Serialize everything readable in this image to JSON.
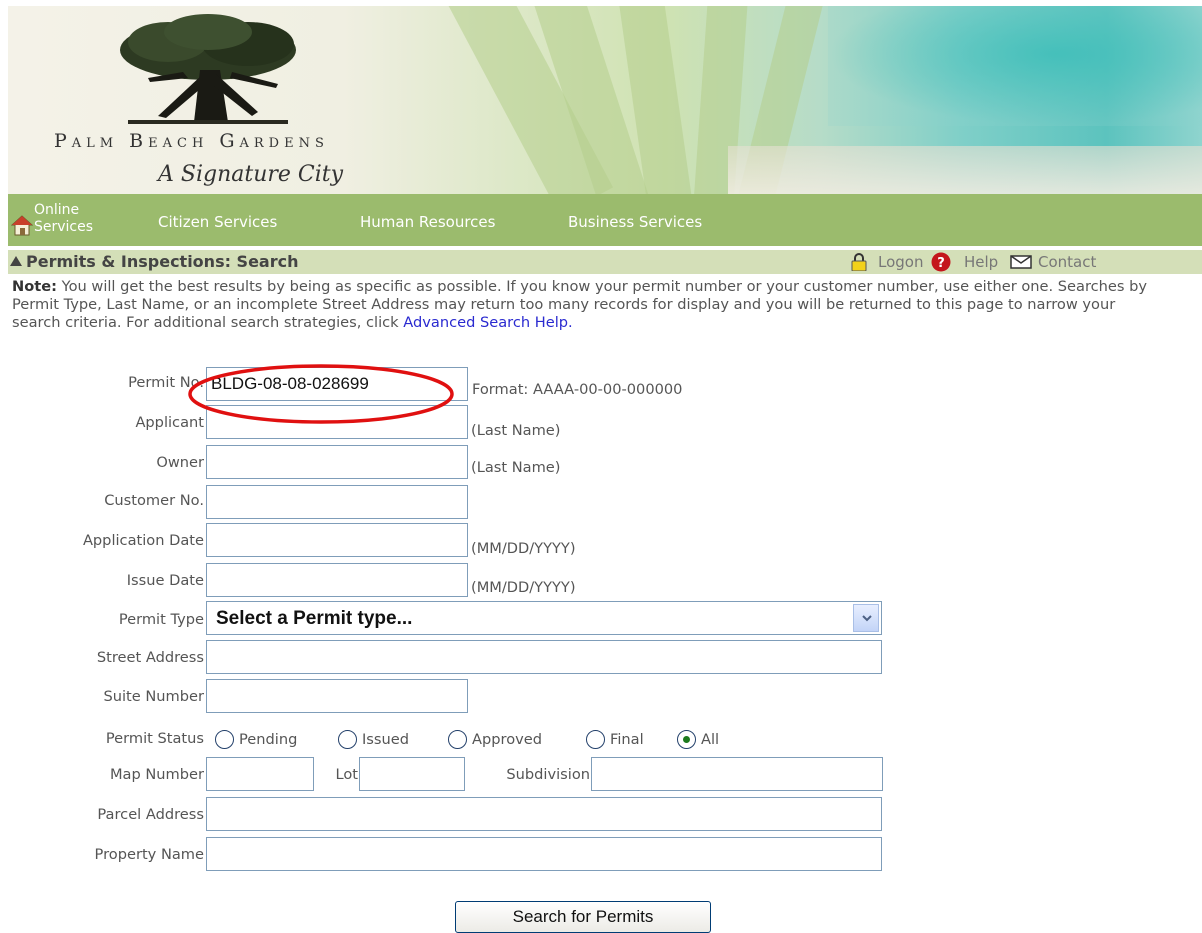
{
  "banner": {
    "brand_name": "Palm Beach Gardens",
    "tagline": "A Signature City"
  },
  "nav": {
    "online_services": [
      "Online",
      "Services"
    ],
    "items": [
      "Citizen Services",
      "Human Resources",
      "Business Services"
    ]
  },
  "titlebar": {
    "title": "Permits & Inspections: Search",
    "logon": "Logon",
    "help": "Help",
    "contact": "Contact"
  },
  "note": {
    "label": "Note:",
    "text": " You will get the best results by being as specific as possible. If you know your permit number or your customer number, use either one. Searches by Permit Type, Last Name, or an incomplete Street Address may return too many records for display and you will be returned to this page to narrow your search criteria. For additional search strategies, click ",
    "link": "Advanced Search Help."
  },
  "form": {
    "permit_no": {
      "label": "Permit No.",
      "value": "BLDG-08-08-028699",
      "hint": "Format: AAAA-00-00-000000"
    },
    "applicant": {
      "label": "Applicant",
      "value": "",
      "hint": "(Last Name)"
    },
    "owner": {
      "label": "Owner",
      "value": "",
      "hint": "(Last Name)"
    },
    "customer_no": {
      "label": "Customer No.",
      "value": ""
    },
    "application_date": {
      "label": "Application Date",
      "value": "",
      "hint": "(MM/DD/YYYY)"
    },
    "issue_date": {
      "label": "Issue Date",
      "value": "",
      "hint": "(MM/DD/YYYY)"
    },
    "permit_type": {
      "label": "Permit Type",
      "selected": "Select a Permit type..."
    },
    "street_address": {
      "label": "Street Address",
      "value": ""
    },
    "suite_number": {
      "label": "Suite Number",
      "value": ""
    },
    "permit_status": {
      "label": "Permit Status",
      "options": [
        "Pending",
        "Issued",
        "Approved",
        "Final",
        "All"
      ],
      "selected": "All"
    },
    "map_number": {
      "label": "Map Number",
      "value": ""
    },
    "lot": {
      "label": "Lot",
      "value": ""
    },
    "subdivision": {
      "label": "Subdivision",
      "value": ""
    },
    "parcel_address": {
      "label": "Parcel Address",
      "value": ""
    },
    "property_name": {
      "label": "Property Name",
      "value": ""
    },
    "submit_label": "Search for Permits"
  },
  "colors": {
    "nav_green": "#9bbb6d",
    "titlebar_green": "#d4dfb8",
    "link_blue": "#2a2ad0",
    "annotation_red": "#e01010"
  }
}
